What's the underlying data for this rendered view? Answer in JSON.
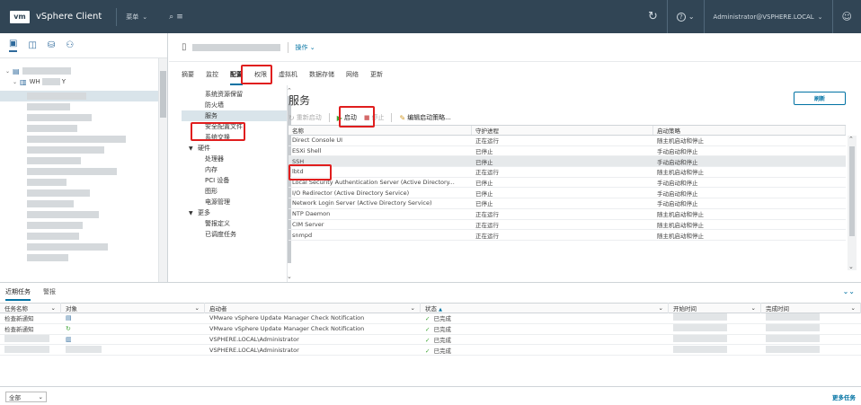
{
  "header": {
    "logo": "vm",
    "app_title": "vSphere Client",
    "menu_label": "菜单",
    "search_glyph": "⌕",
    "help_glyph": "?",
    "user": "Administrator@VSPHERE.LOCAL"
  },
  "tree": {
    "host_label": "WH",
    "host_suffix": "Y"
  },
  "object": {
    "actions_label": "操作"
  },
  "tabs": [
    {
      "label": "摘要"
    },
    {
      "label": "监控"
    },
    {
      "label": "配置"
    },
    {
      "label": "权限"
    },
    {
      "label": "虚拟机"
    },
    {
      "label": "数据存储"
    },
    {
      "label": "网络"
    },
    {
      "label": "更新"
    }
  ],
  "subnav": {
    "items": [
      {
        "label": "系统资源保留",
        "kind": "item"
      },
      {
        "label": "防火墙",
        "kind": "item"
      },
      {
        "label": "服务",
        "kind": "item",
        "selected": true
      },
      {
        "label": "安全配置文件",
        "kind": "item"
      },
      {
        "label": "系统交换",
        "kind": "item"
      },
      {
        "label": "硬件",
        "kind": "group"
      },
      {
        "label": "处理器",
        "kind": "item"
      },
      {
        "label": "内存",
        "kind": "item"
      },
      {
        "label": "PCI 设备",
        "kind": "item"
      },
      {
        "label": "图形",
        "kind": "item"
      },
      {
        "label": "电源管理",
        "kind": "item"
      },
      {
        "label": "更多",
        "kind": "group"
      },
      {
        "label": "警报定义",
        "kind": "item"
      },
      {
        "label": "已调度任务",
        "kind": "item"
      }
    ]
  },
  "services": {
    "title": "服务",
    "refresh_label": "刷新",
    "toolbar": {
      "restart": "重新启动",
      "start": "启动",
      "stop": "停止",
      "edit_policy": "编辑启动策略..."
    },
    "columns": [
      "名称",
      "守护进程",
      "启动策略"
    ],
    "rows": [
      {
        "name": "Direct Console UI",
        "daemon": "正在运行",
        "policy": "随主机启动和停止"
      },
      {
        "name": "ESXi Shell",
        "daemon": "已停止",
        "policy": "手动启动和停止"
      },
      {
        "name": "SSH",
        "daemon": "已停止",
        "policy": "手动启动和停止",
        "selected": true
      },
      {
        "name": "lbtd",
        "daemon": "正在运行",
        "policy": "随主机启动和停止"
      },
      {
        "name": "Local Security Authentication Server (Active Directory...",
        "daemon": "已停止",
        "policy": "手动启动和停止"
      },
      {
        "name": "I/O Redirector (Active Directory Service)",
        "daemon": "已停止",
        "policy": "手动启动和停止"
      },
      {
        "name": "Network Login Server (Active Directory Service)",
        "daemon": "已停止",
        "policy": "手动启动和停止"
      },
      {
        "name": "NTP Daemon",
        "daemon": "正在运行",
        "policy": "随主机启动和停止"
      },
      {
        "name": "CIM Server",
        "daemon": "正在运行",
        "policy": "随主机启动和停止"
      },
      {
        "name": "snmpd",
        "daemon": "正在运行",
        "policy": "随主机启动和停止"
      }
    ]
  },
  "tasks": {
    "tabs": [
      "近期任务",
      "警报"
    ],
    "columns": [
      "任务名称",
      "对象",
      "启动者",
      "状态",
      "开始时间",
      "完成时间"
    ],
    "sort_glyph": "▲",
    "rows": [
      {
        "name": "检查新通知",
        "initiator": "VMware vSphere Update Manager Check Notification",
        "status": "已完成"
      },
      {
        "name": "检查新通知",
        "initiator": "VMware vSphere Update Manager Check Notification",
        "status": "已完成"
      },
      {
        "name": "",
        "initiator": "VSPHERE.LOCAL\\Administrator",
        "status": "已完成"
      },
      {
        "name": "",
        "initiator": "VSPHERE.LOCAL\\Administrator",
        "status": "已完成"
      }
    ],
    "filter_value": "全部",
    "more_tasks": "更多任务"
  }
}
